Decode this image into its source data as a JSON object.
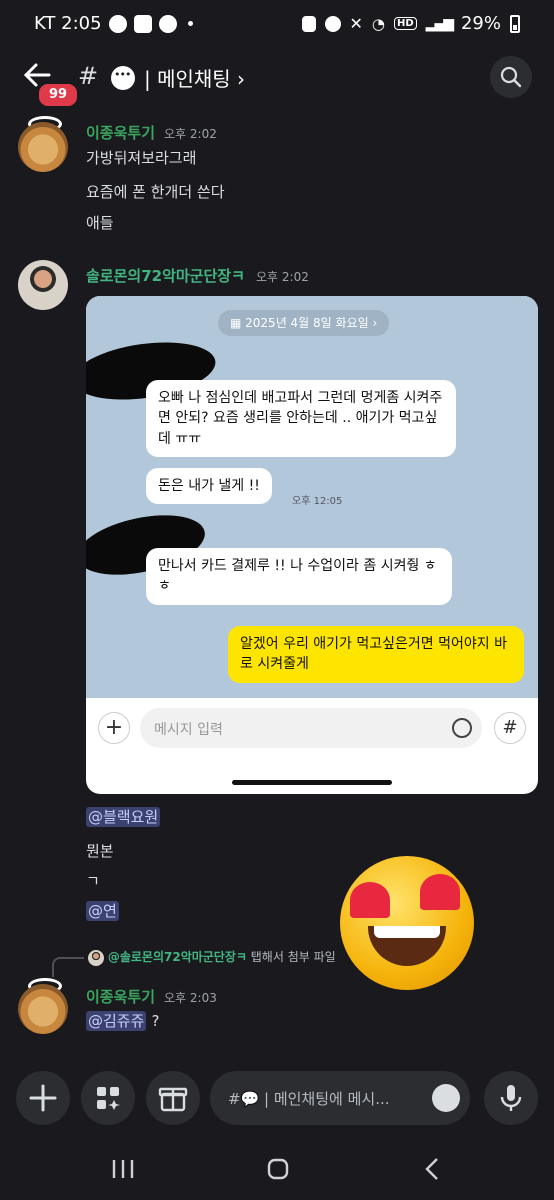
{
  "status_bar": {
    "carrier_time": "KT 2:05",
    "battery": "29%",
    "hd": "HD"
  },
  "header": {
    "back_icon": "arrow-left-icon",
    "unread_badge": "99",
    "channel_prefix": "#",
    "channel_title": "| 메인채팅 ›"
  },
  "messages": [
    {
      "author": "이종욱투기",
      "time": "오후 2:02",
      "lines": [
        "가방뒤져보라그래",
        "요즘에 폰 한개더 쓴다",
        "애들"
      ]
    },
    {
      "author": "솔로몬의72악마군단장ㅋ",
      "time": "오후 2:02"
    }
  ],
  "embedded_chat": {
    "date": "2025년 4월 8일 화요일 ›",
    "bubbles": [
      {
        "from": "other",
        "text": "오빠 나 점심인데 배고파서 그런데 멍게좀 시켜주면 안되? 요즘 생리를 안하는데 .. 애기가 먹고싶데 ㅠㅠ"
      },
      {
        "from": "other",
        "text": "돈은 내가 낼게 !!",
        "time": "오후 12:05"
      },
      {
        "from": "other",
        "text": "만나서 카드 결제루 !! 나 수업이라 좀 시켜줭 ㅎㅎ"
      },
      {
        "from": "me",
        "text": "알겠어 우리 애기가 먹고싶은거면 먹어야지 바로 시켜줄게"
      }
    ],
    "input_placeholder": "메시지 입력"
  },
  "after_image": {
    "mention1": "@블랙요원",
    "line2": "뭔본",
    "line3": "ㄱ",
    "mention2": "@연"
  },
  "reply_preview": {
    "author": "@솔로몬의72악마군단장ㅋ",
    "text": "탭해서 첨부 파일 보기"
  },
  "last_message": {
    "author": "이종욱투기",
    "time": "오후 2:03",
    "mention": "@김쥬쥬",
    "suffix": "?"
  },
  "composer": {
    "placeholder": "#💬 | 메인채팅에 메시..."
  }
}
